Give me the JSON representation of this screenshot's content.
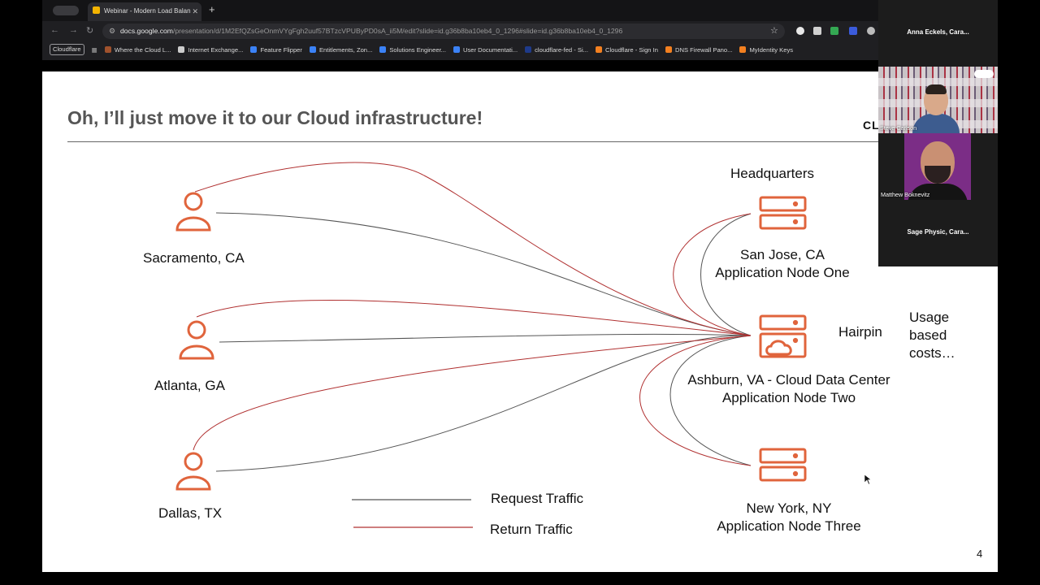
{
  "browser": {
    "tab_title": "Webinar - Modern Load Balan",
    "tab_close": "✕",
    "new_tab": "+",
    "url_host": "docs.google.com",
    "url_path": "/presentation/d/1M2EfQZsGeOnmVYgFgh2uuf57BTzcVPUByPD0sA_ii5M/edit?slide=id.g36b8ba10eb4_0_1296#slide=id.g36b8ba10eb4_0_1296",
    "bookmarks": [
      {
        "label": "Cloudflare",
        "color": "#ffffff"
      },
      {
        "label": "Where the Cloud L...",
        "color": "#a0522d"
      },
      {
        "label": "Internet Exchange...",
        "color": "#cccccc"
      },
      {
        "label": "Feature Flipper",
        "color": "#3b82f6"
      },
      {
        "label": "Entitlements, Zon...",
        "color": "#3b82f6"
      },
      {
        "label": "Solutions Engineer...",
        "color": "#3b82f6"
      },
      {
        "label": "User Documentati...",
        "color": "#3b82f6"
      },
      {
        "label": "cloudflare-fed - Si...",
        "color": "#1e3a8a"
      },
      {
        "label": "Cloudflare - Sign In",
        "color": "#f38020"
      },
      {
        "label": "DNS Firewall Pano...",
        "color": "#f38020"
      },
      {
        "label": "MyIdentity Keys",
        "color": "#f38020"
      }
    ]
  },
  "slide": {
    "title": "Oh, I’ll just move it to our Cloud infrastructure!",
    "brand_fragment": "CL",
    "page_number": "4",
    "users": [
      {
        "label": "Sacramento, CA"
      },
      {
        "label": "Atlanta, GA"
      },
      {
        "label": "Dallas, TX"
      }
    ],
    "headquarters_label": "Headquarters",
    "nodes": [
      {
        "line1": "San Jose, CA",
        "line2": "Application Node One"
      },
      {
        "line1": "Ashburn, VA - Cloud Data Center",
        "line2": "Application Node Two"
      },
      {
        "line1": "New York, NY",
        "line2": "Application Node Three"
      }
    ],
    "hairpin_label": "Hairpin",
    "usage_note": [
      "Usage",
      "based",
      "costs…"
    ],
    "legend": {
      "request": {
        "label": "Request Traffic",
        "color": "#555555"
      },
      "return": {
        "label": "Return Traffic",
        "color": "#b03030"
      }
    },
    "accent_color": "#e0643c"
  },
  "participants": {
    "top_name": "Anna Eckels, Cara...",
    "video1_name": "Steve Carlson",
    "video2_name": "Matthew Boknevitz",
    "bottom_name": "Sage Physic, Cara..."
  }
}
